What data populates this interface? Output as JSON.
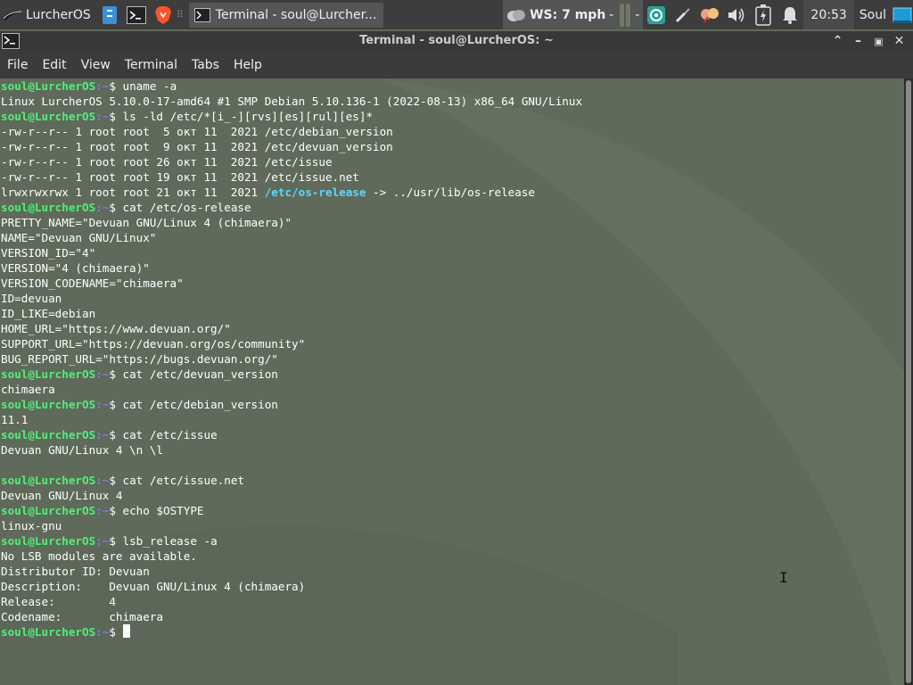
{
  "panel": {
    "menu_label": "LurcherOS",
    "task_label": "Terminal - soul@Lurcher...",
    "weather": "WS: 7 mph",
    "weather_sep": "-",
    "clock": "20:53",
    "user": "Soul"
  },
  "window": {
    "title": "Terminal - soul@LurcherOS: ~"
  },
  "menubar": [
    "File",
    "Edit",
    "View",
    "Terminal",
    "Tabs",
    "Help"
  ],
  "terminal": {
    "prompt_user": "soul@LurcherOS",
    "prompt_path": ":~",
    "prompt_dollar": "$ ",
    "lines": [
      {
        "type": "cmd",
        "text": "uname -a"
      },
      {
        "type": "out",
        "text": "Linux LurcherOS 5.10.0-17-amd64 #1 SMP Debian 5.10.136-1 (2022-08-13) x86_64 GNU/Linux"
      },
      {
        "type": "cmd",
        "text": "ls -ld /etc/*[i_-][rvs][es][rul][es]*"
      },
      {
        "type": "out",
        "text": "-rw-r--r-- 1 root root  5 окт 11  2021 /etc/debian_version"
      },
      {
        "type": "out",
        "text": "-rw-r--r-- 1 root root  9 окт 11  2021 /etc/devuan_version"
      },
      {
        "type": "out",
        "text": "-rw-r--r-- 1 root root 26 окт 11  2021 /etc/issue"
      },
      {
        "type": "out",
        "text": "-rw-r--r-- 1 root root 19 окт 11  2021 /etc/issue.net"
      },
      {
        "type": "link",
        "pre": "lrwxrwxrwx 1 root root 21 окт 11  2021 ",
        "link": "/etc/os-release",
        "post": " -> ../usr/lib/os-release"
      },
      {
        "type": "cmd",
        "text": "cat /etc/os-release"
      },
      {
        "type": "out",
        "text": "PRETTY_NAME=\"Devuan GNU/Linux 4 (chimaera)\""
      },
      {
        "type": "out",
        "text": "NAME=\"Devuan GNU/Linux\""
      },
      {
        "type": "out",
        "text": "VERSION_ID=\"4\""
      },
      {
        "type": "out",
        "text": "VERSION=\"4 (chimaera)\""
      },
      {
        "type": "out",
        "text": "VERSION_CODENAME=\"chimaera\""
      },
      {
        "type": "out",
        "text": "ID=devuan"
      },
      {
        "type": "out",
        "text": "ID_LIKE=debian"
      },
      {
        "type": "out",
        "text": "HOME_URL=\"https://www.devuan.org/\""
      },
      {
        "type": "out",
        "text": "SUPPORT_URL=\"https://devuan.org/os/community\""
      },
      {
        "type": "out",
        "text": "BUG_REPORT_URL=\"https://bugs.devuan.org/\""
      },
      {
        "type": "cmd",
        "text": "cat /etc/devuan_version"
      },
      {
        "type": "out",
        "text": "chimaera"
      },
      {
        "type": "cmd",
        "text": "cat /etc/debian_version"
      },
      {
        "type": "out",
        "text": "11.1"
      },
      {
        "type": "cmd",
        "text": "cat /etc/issue"
      },
      {
        "type": "out",
        "text": "Devuan GNU/Linux 4 \\n \\l"
      },
      {
        "type": "out",
        "text": ""
      },
      {
        "type": "cmd",
        "text": "cat /etc/issue.net"
      },
      {
        "type": "out",
        "text": "Devuan GNU/Linux 4"
      },
      {
        "type": "cmd",
        "text": "echo $OSTYPE"
      },
      {
        "type": "out",
        "text": "linux-gnu"
      },
      {
        "type": "cmd",
        "text": "lsb_release -a"
      },
      {
        "type": "out",
        "text": "No LSB modules are available."
      },
      {
        "type": "out",
        "text": "Distributor ID:\tDevuan"
      },
      {
        "type": "out",
        "text": "Description:\tDevuan GNU/Linux 4 (chimaera)"
      },
      {
        "type": "out",
        "text": "Release:\t4"
      },
      {
        "type": "out",
        "text": "Codename:\tchimaera"
      },
      {
        "type": "cmd",
        "text": "",
        "cursor": true
      }
    ]
  },
  "colors": {
    "background": "#5f6a5a",
    "prompt": "#4ff07a",
    "path": "#6f7df5",
    "link": "#5cd8ff"
  }
}
